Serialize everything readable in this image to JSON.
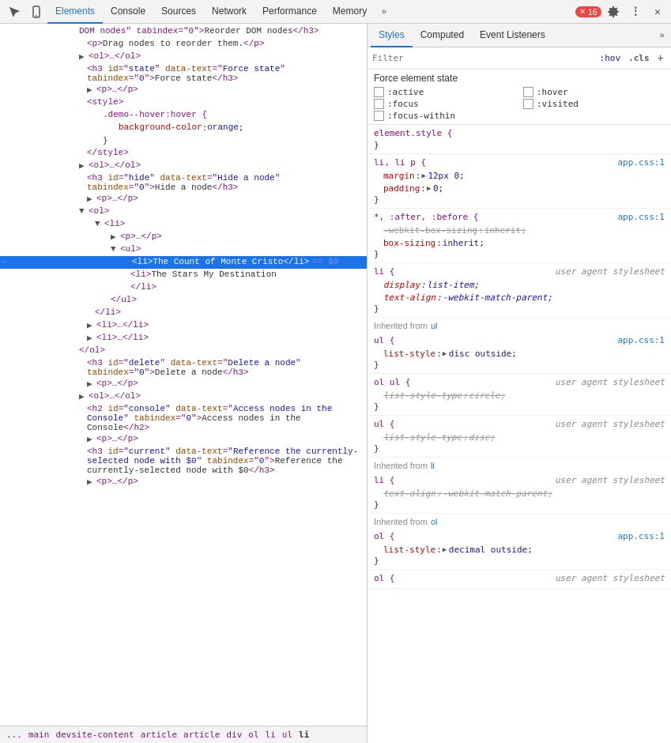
{
  "topTabs": {
    "items": [
      {
        "label": "Elements",
        "active": true
      },
      {
        "label": "Console",
        "active": false
      },
      {
        "label": "Sources",
        "active": false
      },
      {
        "label": "Network",
        "active": false
      },
      {
        "label": "Performance",
        "active": false
      },
      {
        "label": "Memory",
        "active": false
      }
    ],
    "overflow": "»",
    "errorCount": "16",
    "icons": {
      "settings": "⚙",
      "more": "⋮",
      "close": "✕",
      "inspect": "🔍",
      "device": "📱"
    }
  },
  "stylesTabs": {
    "items": [
      {
        "label": "Styles",
        "active": true
      },
      {
        "label": "Computed",
        "active": false
      },
      {
        "label": "Event Listeners",
        "active": false
      }
    ],
    "overflow": "»"
  },
  "filter": {
    "placeholder": "Filter",
    "hov": ":hov",
    "cls": ".cls",
    "add": "+"
  },
  "forceState": {
    "title": "Force element state",
    "options": [
      {
        "label": ":active",
        "checked": false,
        "col": 0
      },
      {
        "label": ":hover",
        "checked": false,
        "col": 1
      },
      {
        "label": ":focus",
        "checked": false,
        "col": 0
      },
      {
        "label": ":visited",
        "checked": false,
        "col": 1
      },
      {
        "label": ":focus-within",
        "checked": false,
        "col": 0
      }
    ]
  },
  "styleRules": [
    {
      "selector": "element.style {",
      "source": "",
      "props": [],
      "closingBrace": "}"
    },
    {
      "selector": "li, li p {",
      "source": "app.css:1",
      "props": [
        {
          "name": "margin",
          "colon": ":",
          "triangle": "▶",
          "val": " 12px 0;",
          "strikethrough": false
        },
        {
          "name": "padding",
          "colon": ":",
          "triangle": "▶",
          "val": " 0;",
          "strikethrough": false
        }
      ],
      "closingBrace": "}"
    },
    {
      "selector": "*, :after, :before {",
      "source": "app.css:1",
      "props": [
        {
          "name": "-webkit-box-sizing: inherit;",
          "colon": "",
          "val": "",
          "strikethrough": true
        },
        {
          "name": "box-sizing",
          "colon": ":",
          "val": " inherit;",
          "strikethrough": false
        }
      ],
      "closingBrace": "}"
    },
    {
      "selector": "li {",
      "source": "user agent stylesheet",
      "sourceItalic": true,
      "props": [
        {
          "name": "display",
          "colon": ":",
          "val": " list-item;",
          "strikethrough": false
        },
        {
          "name": "text-align",
          "colon": ":",
          "val": " -webkit-match-parent;",
          "strikethrough": false
        }
      ],
      "closingBrace": "}"
    },
    {
      "inheritedFrom": "ul",
      "type": "inherited"
    },
    {
      "selector": "ul {",
      "source": "app.css:1",
      "props": [
        {
          "name": "list-style",
          "colon": ":",
          "triangle": "▶",
          "val": " disc outside;",
          "strikethrough": false
        }
      ],
      "closingBrace": "}"
    },
    {
      "selector": "ol ul {",
      "source": "user agent stylesheet",
      "sourceItalic": true,
      "props": [
        {
          "name": "list-style-type: circle;",
          "colon": "",
          "val": "",
          "strikethrough": true
        }
      ],
      "closingBrace": "}"
    },
    {
      "selector": "ul {",
      "source": "user agent stylesheet",
      "sourceItalic": true,
      "props": [
        {
          "name": "list-style-type: disc;",
          "colon": "",
          "val": "",
          "strikethrough": true
        }
      ],
      "closingBrace": "}"
    },
    {
      "inheritedFrom": "li",
      "type": "inherited"
    },
    {
      "selector": "li {",
      "source": "user agent stylesheet",
      "sourceItalic": true,
      "props": [
        {
          "name": "text-align: -webkit-match-parent;",
          "colon": "",
          "val": "",
          "strikethrough": true
        }
      ],
      "closingBrace": "}"
    },
    {
      "inheritedFrom": "ol",
      "type": "inherited"
    },
    {
      "selector": "ol {",
      "source": "app.css:1",
      "props": [
        {
          "name": "list-style",
          "colon": ":",
          "triangle": "▶",
          "val": " decimal outside;",
          "strikethrough": false
        }
      ],
      "closingBrace": "}"
    }
  ],
  "breadcrumbs": [
    "...",
    "main",
    "devsite-content",
    "article",
    "article",
    "div",
    "ol",
    "li",
    "ul",
    "li"
  ],
  "domLines": [
    {
      "indent": 0,
      "content": "DOM nodes\" tabindex=\"0\">Reorder DOM nodes</h3>",
      "type": "text"
    },
    {
      "indent": 1,
      "content": "<p>Drag nodes to reorder them.</p>",
      "type": "tag"
    },
    {
      "indent": 1,
      "arrow": "▶",
      "content": "<ol>…</ol>",
      "type": "tag"
    },
    {
      "indent": 1,
      "content": "<h3 id=\"state\" data-text=\"Force state\" tabindex=\"0\">Force state</h3>",
      "type": "tag",
      "multiline": true
    },
    {
      "indent": 1,
      "arrow": "▶",
      "content": "<p>…</p>",
      "type": "tag"
    },
    {
      "indent": 1,
      "content": "<style>",
      "type": "tag"
    },
    {
      "indent": 2,
      "content": ".demo--hover:hover {",
      "type": "css"
    },
    {
      "indent": 3,
      "content": "background-color: orange;",
      "type": "css"
    },
    {
      "indent": 2,
      "content": "}",
      "type": "css"
    },
    {
      "indent": 1,
      "content": "</style>",
      "type": "tag"
    },
    {
      "indent": 1,
      "arrow": "▶",
      "content": "<ol>…</ol>",
      "type": "tag"
    },
    {
      "indent": 1,
      "content": "<h3 id=\"hide\" data-text=\"Hide a node\" tabindex=\"0\">Hide a node</h3>",
      "type": "tag",
      "multiline": true
    },
    {
      "indent": 1,
      "arrow": "▶",
      "content": "<p>…</p>",
      "type": "tag"
    },
    {
      "indent": 1,
      "arrow": "▼",
      "content": "<ol>",
      "type": "tag"
    },
    {
      "indent": 2,
      "arrow": "▼",
      "content": "<li>",
      "type": "tag"
    },
    {
      "indent": 3,
      "arrow": "▶",
      "content": "<p>…</p>",
      "type": "tag"
    },
    {
      "indent": 3,
      "arrow": "▼",
      "content": "<ul>",
      "type": "tag"
    },
    {
      "indent": 4,
      "content": "<li>The Count of Monte Cristo</li>",
      "type": "tag",
      "selected": true,
      "dollar": "== $0",
      "dotted": true
    },
    {
      "indent": 4,
      "content": "<li>The Stars My Destination</li>",
      "type": "tag",
      "multiline2": true
    },
    {
      "indent": 3,
      "content": "</ul>",
      "type": "tag"
    },
    {
      "indent": 2,
      "content": "</li>",
      "type": "tag"
    },
    {
      "indent": 2,
      "arrow": "▶",
      "content": "<li>…</li>",
      "type": "tag"
    },
    {
      "indent": 2,
      "arrow": "▶",
      "content": "<li>…</li>",
      "type": "tag"
    },
    {
      "indent": 1,
      "content": "</ol>",
      "type": "tag"
    },
    {
      "indent": 1,
      "content": "<h3 id=\"delete\" data-text=\"Delete a node\" tabindex=\"0\">Delete a node</h3>",
      "type": "tag",
      "multiline": true
    },
    {
      "indent": 1,
      "arrow": "▶",
      "content": "<p>…</p>",
      "type": "tag"
    },
    {
      "indent": 1,
      "arrow": "▶",
      "content": "<ol>…</ol>",
      "type": "tag"
    },
    {
      "indent": 1,
      "content": "<h2 id=\"console\" data-text=\"Access nodes in the Console\" tabindex=\"0\">Access nodes in the Console</h2>",
      "type": "tag",
      "multiline": true
    },
    {
      "indent": 1,
      "arrow": "▶",
      "content": "<p>…</p>",
      "type": "tag"
    },
    {
      "indent": 1,
      "content": "<h3 id=\"current\" data-text=\"Reference the currently-selected node with $0\" tabindex=\"0\">Reference the currently-selected node with $0</h3>",
      "type": "tag",
      "multiline": true
    },
    {
      "indent": 1,
      "arrow": "▶",
      "content": "<p>…</p>",
      "type": "tag"
    }
  ]
}
